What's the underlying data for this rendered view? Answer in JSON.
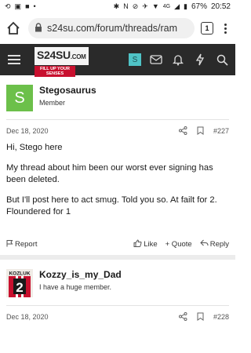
{
  "status_bar": {
    "battery": "67%",
    "time": "20:52",
    "network": "4G"
  },
  "browser": {
    "url": "s24su.com/forum/threads/ram",
    "tab_count": "1"
  },
  "site": {
    "logo_text": "S24SU",
    "logo_suffix": ".COM",
    "tagline": "FILL UP YOUR SENSES",
    "user_initial": "S"
  },
  "posts": [
    {
      "username": "Stegosaurus",
      "user_title": "Member",
      "avatar_letter": "S",
      "date": "Dec 18, 2020",
      "post_number": "#227",
      "paragraphs": [
        "Hi, Stego here",
        "My thread about him been our worst ever signing has been deleted.",
        "But I'll post here to act smug. Told you so. At failt for 2. Floundered for 1"
      ],
      "actions": {
        "report": "Report",
        "like": "Like",
        "quote": "+ Quote",
        "reply": "Reply"
      }
    },
    {
      "username": "Kozzy_is_my_Dad",
      "user_title": "I have a huge member.",
      "avatar_text": "KOZLUK",
      "avatar_number": "2",
      "date": "Dec 18, 2020",
      "post_number": "#228"
    }
  ]
}
